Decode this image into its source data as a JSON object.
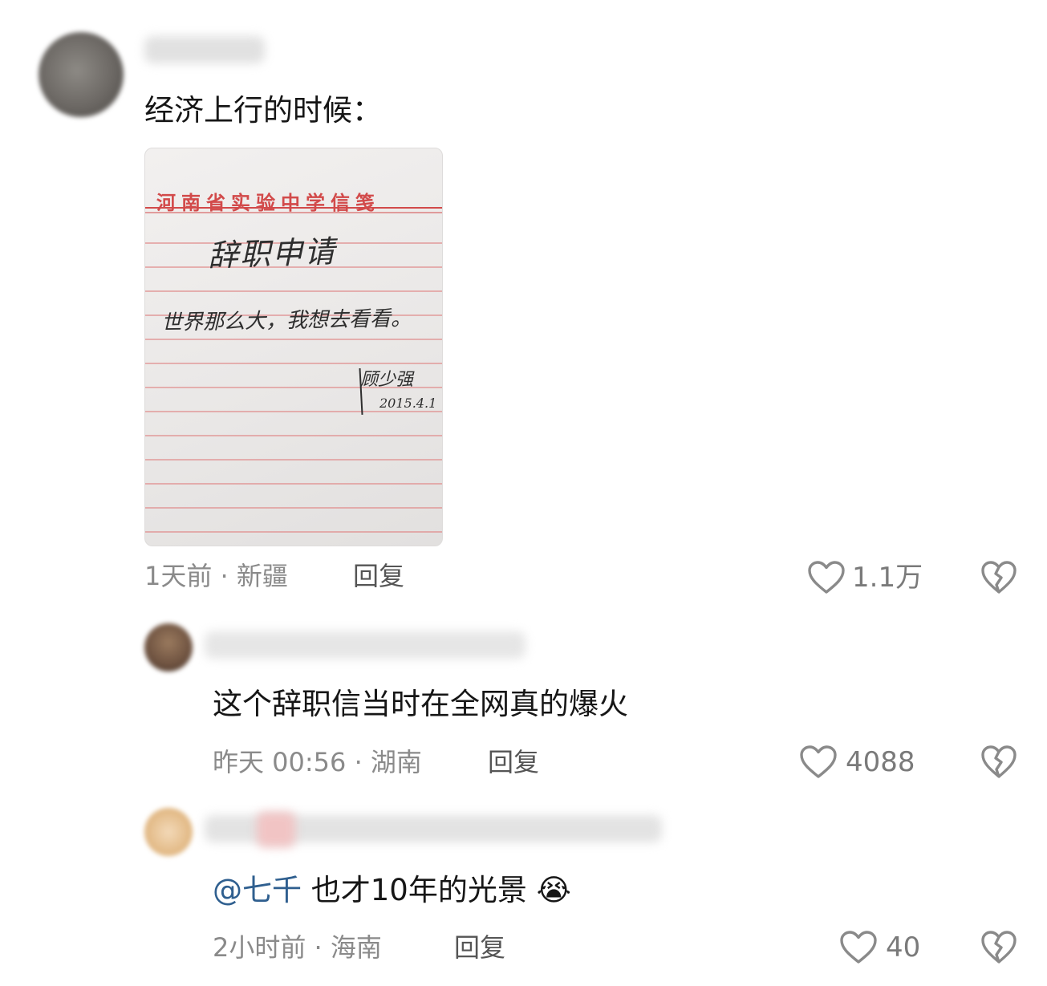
{
  "comments": [
    {
      "text": "经济上行的时候：",
      "image": {
        "letterhead": "河南省实验中学信笺",
        "title": "辞职申请",
        "body": "世界那么大，我想去看看。",
        "signature": "顾少强",
        "date": "2015.4.1"
      },
      "time": "1天前",
      "location": "新疆",
      "reply_label": "回复",
      "likes": "1.1万"
    },
    {
      "text": "这个辞职信当时在全网真的爆火",
      "time": "昨天 00:56",
      "location": "湖南",
      "reply_label": "回复",
      "likes": "4088"
    },
    {
      "mention": "@七千",
      "text": "也才10年的光景",
      "emoji": "😭",
      "time": "2小时前",
      "location": "海南",
      "reply_label": "回复",
      "likes": "40"
    }
  ],
  "separator": "·",
  "icons": {
    "like": "heart-outline-icon",
    "dislike": "broken-heart-icon"
  },
  "colors": {
    "letterhead_red": "#d24a4a",
    "mention_blue": "#2f5f8f",
    "meta_gray": "#8a8a8a"
  }
}
